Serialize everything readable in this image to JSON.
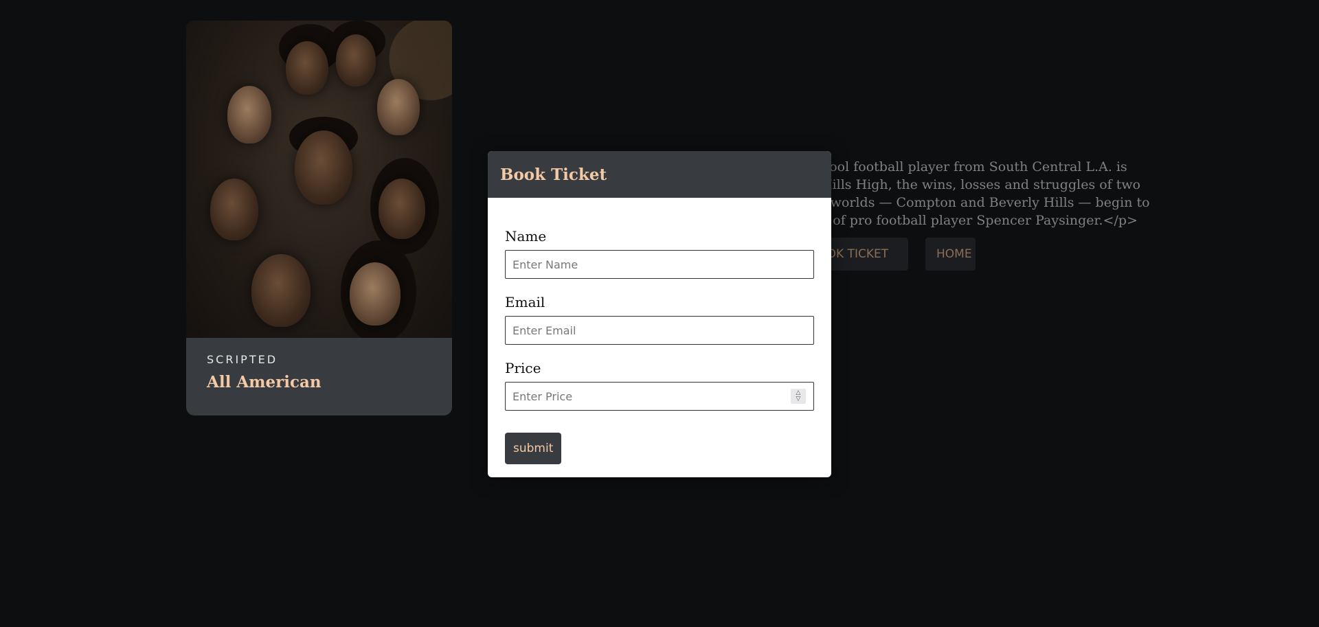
{
  "show": {
    "genre": "SCRIPTED",
    "title": "All American",
    "description_lines": [
      "hool football player from South Central L.A. is",
      "Hills High, the wins, losses and struggles of two",
      "t worlds — Compton and Beverly Hills — begin to",
      "e of pro football player Spencer Paysinger.</p>"
    ],
    "book_button": "BOOK TICKET",
    "home_button": "HOME"
  },
  "modal": {
    "title": "Book Ticket",
    "fields": {
      "name": {
        "label": "Name",
        "placeholder": "Enter Name",
        "value": ""
      },
      "email": {
        "label": "Email",
        "placeholder": "Enter Email",
        "value": ""
      },
      "price": {
        "label": "Price",
        "placeholder": "Enter Price",
        "value": ""
      }
    },
    "submit_label": "submit"
  },
  "colors": {
    "background": "#0d0e10",
    "panel": "#383b3f",
    "accent": "#f4c9a5"
  },
  "icons": {
    "stepper": "number-stepper-icon"
  }
}
